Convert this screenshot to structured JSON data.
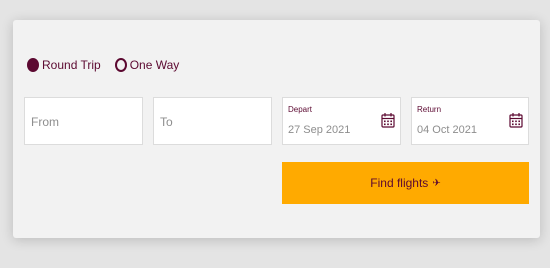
{
  "trip_type": {
    "options": [
      {
        "label": "Round Trip",
        "selected": true
      },
      {
        "label": "One Way",
        "selected": false
      }
    ]
  },
  "from": {
    "placeholder": "From"
  },
  "to": {
    "placeholder": "To"
  },
  "depart": {
    "label": "Depart",
    "value": "27 Sep 2021",
    "icon": "calendar-icon"
  },
  "return_date": {
    "label": "Return",
    "value": "04 Oct 2021",
    "icon": "calendar-icon"
  },
  "search": {
    "button_label": "Find flights",
    "icon": "plane-icon"
  },
  "colors": {
    "brand": "#5c0931",
    "accent": "#ffaa00"
  }
}
